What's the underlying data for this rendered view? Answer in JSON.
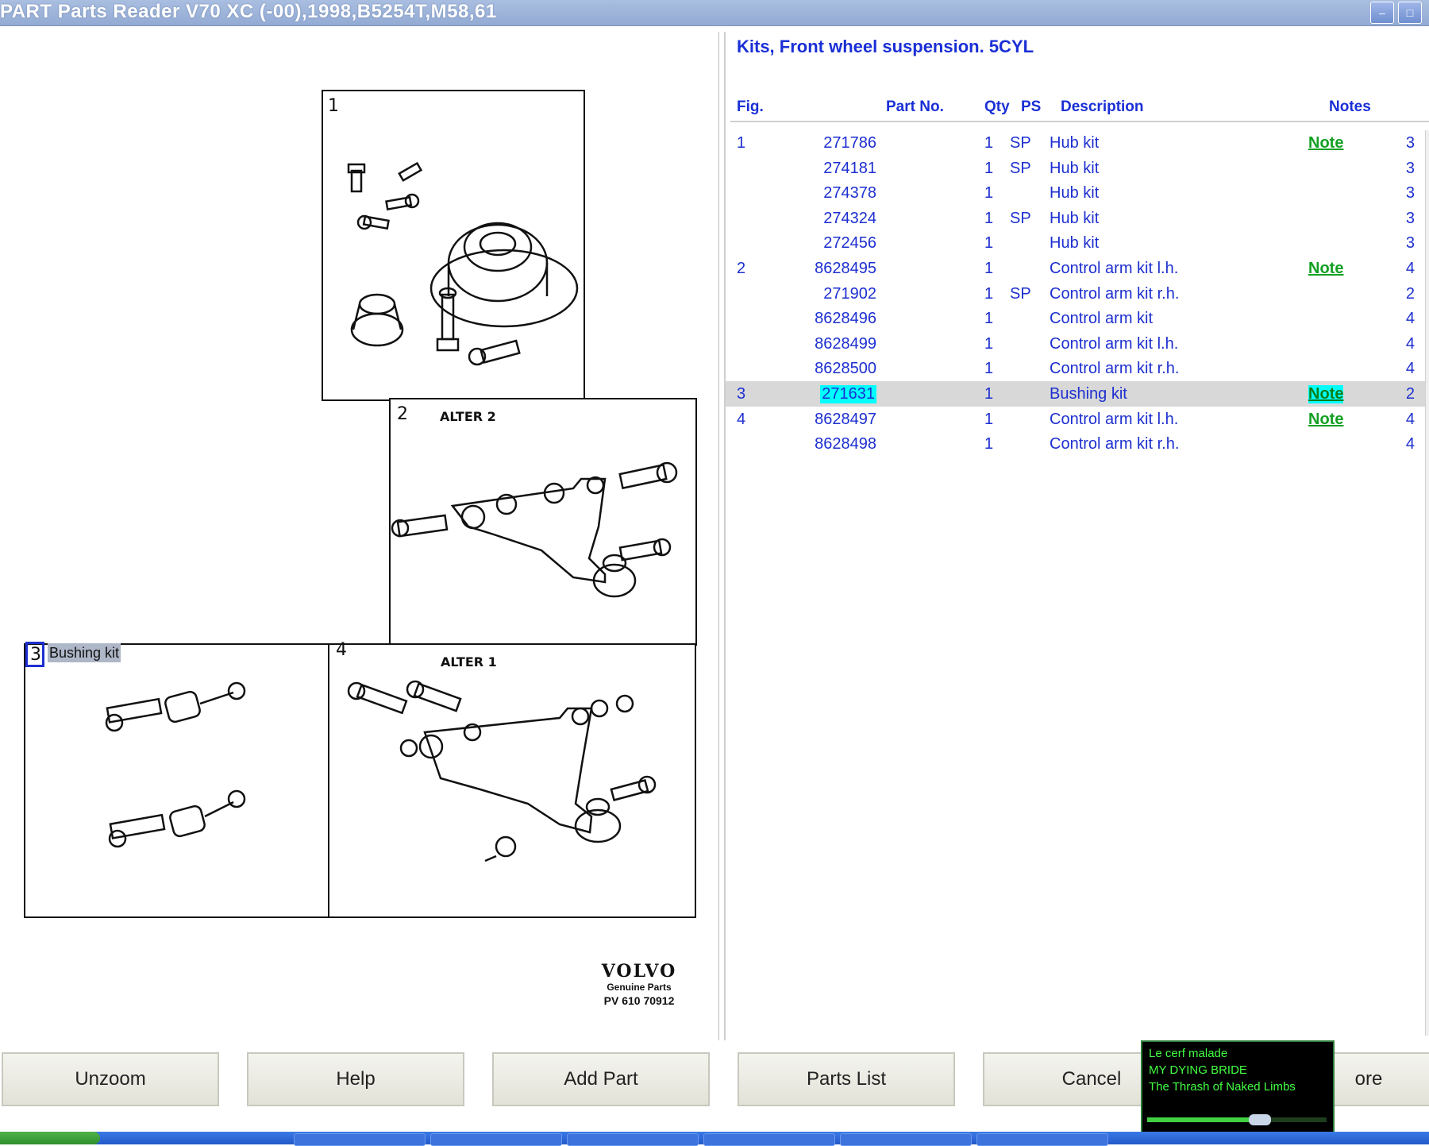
{
  "window": {
    "title": "PART Parts Reader V70 XC (-00),1998,B5254T,M58,61",
    "controls": {
      "minimize": "minimize-icon",
      "maximize": "maximize-icon"
    }
  },
  "drawing": {
    "figures": [
      "1",
      "2",
      "3",
      "4"
    ],
    "alter2": "ALTER 2",
    "alter1": "ALTER 1",
    "selected_label": "Bushing kit",
    "brand": "VOLVO",
    "brand_sub": "Genuine Parts",
    "ref": "PV 610 70912"
  },
  "list": {
    "title": "Kits, Front wheel suspension. 5CYL",
    "headers": {
      "fig": "Fig.",
      "part": "Part No.",
      "qty": "Qty",
      "ps": "PS",
      "desc": "Description",
      "notes": "Notes"
    },
    "rows": [
      {
        "fig": "1",
        "part": "271786",
        "qty": "1",
        "ps": "SP",
        "desc": "Hub kit",
        "note": "Note",
        "num": "3"
      },
      {
        "fig": "",
        "part": "274181",
        "qty": "1",
        "ps": "SP",
        "desc": "Hub kit",
        "note": "",
        "num": "3"
      },
      {
        "fig": "",
        "part": "274378",
        "qty": "1",
        "ps": "",
        "desc": "Hub kit",
        "note": "",
        "num": "3"
      },
      {
        "fig": "",
        "part": "274324",
        "qty": "1",
        "ps": "SP",
        "desc": "Hub kit",
        "note": "",
        "num": "3"
      },
      {
        "fig": "",
        "part": "272456",
        "qty": "1",
        "ps": "",
        "desc": "Hub kit",
        "note": "",
        "num": "3"
      },
      {
        "fig": "2",
        "part": "8628495",
        "qty": "1",
        "ps": "",
        "desc": "Control arm kit l.h.",
        "note": "Note",
        "num": "4"
      },
      {
        "fig": "",
        "part": "271902",
        "qty": "1",
        "ps": "SP",
        "desc": "Control arm kit r.h.",
        "note": "",
        "num": "2"
      },
      {
        "fig": "",
        "part": "8628496",
        "qty": "1",
        "ps": "",
        "desc": "Control arm kit",
        "note": "",
        "num": "4"
      },
      {
        "fig": "",
        "part": "8628499",
        "qty": "1",
        "ps": "",
        "desc": "Control arm kit l.h.",
        "note": "",
        "num": "4"
      },
      {
        "fig": "",
        "part": "8628500",
        "qty": "1",
        "ps": "",
        "desc": "Control arm kit r.h.",
        "note": "",
        "num": "4"
      },
      {
        "fig": "3",
        "part": "271631",
        "qty": "1",
        "ps": "",
        "desc": "Bushing kit",
        "note": "Note",
        "num": "2"
      },
      {
        "fig": "4",
        "part": "8628497",
        "qty": "1",
        "ps": "",
        "desc": "Control arm kit l.h.",
        "note": "Note",
        "num": "4"
      },
      {
        "fig": "",
        "part": "8628498",
        "qty": "1",
        "ps": "",
        "desc": "Control arm kit r.h.",
        "note": "",
        "num": "4"
      }
    ],
    "selected_index": 10
  },
  "buttons": {
    "unzoom": "Unzoom",
    "help": "Help",
    "add_part": "Add Part",
    "parts_list": "Parts List",
    "cancel": "Cancel",
    "more_partial": "ore"
  },
  "media": {
    "line1": "Le cerf malade",
    "line2": "MY DYING BRIDE",
    "line3": "The Thrash of Naked Limbs",
    "progress": 0.62
  },
  "colors": {
    "accent_blue": "#1a2fd6",
    "note_green": "#13a023",
    "highlight_cyan": "#00ffff",
    "selected_row": "#d8d8d8"
  }
}
